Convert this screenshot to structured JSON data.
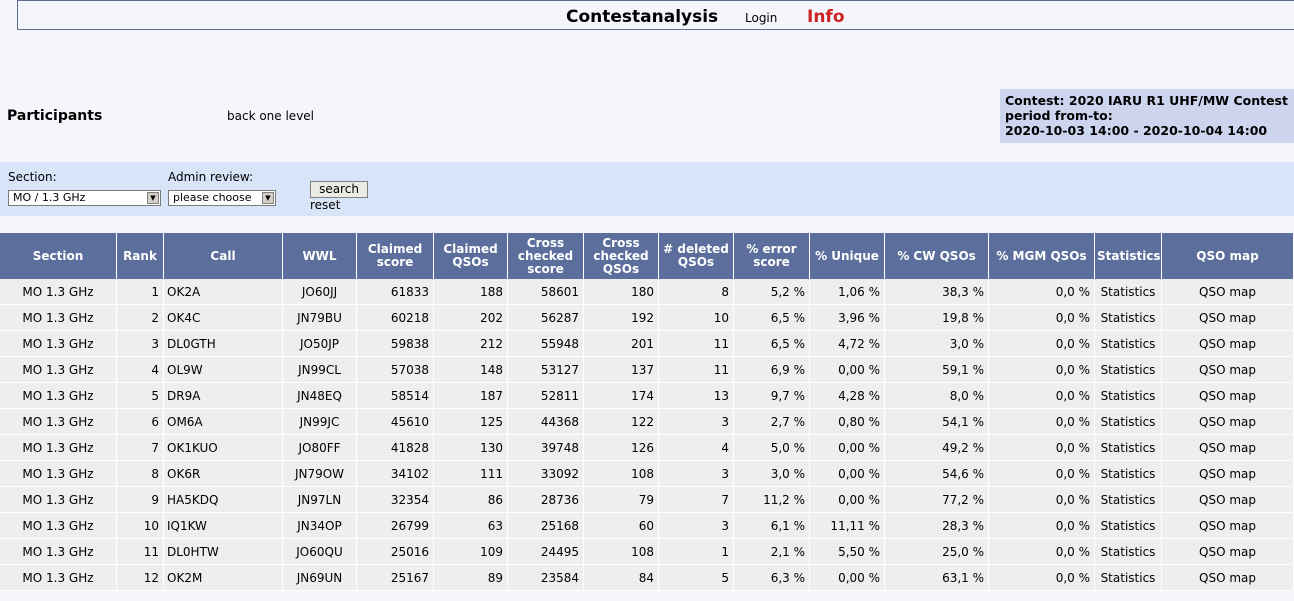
{
  "header": {
    "title": "Contestanalysis",
    "login": "Login",
    "info": "Info"
  },
  "page": {
    "heading": "Participants",
    "back": "back one level"
  },
  "contest": {
    "line1": "Contest: 2020 IARU R1 UHF/MW Contest",
    "line2": "period from-to:",
    "line3": "2020-10-03 14:00 - 2020-10-04 14:00"
  },
  "filters": {
    "section_label": "Section:",
    "section_value": "MO / 1.3 GHz",
    "review_label": "Admin review:",
    "review_value": "please choose",
    "search": "search",
    "reset": "reset"
  },
  "table": {
    "headers": [
      "Section",
      "Rank",
      "Call",
      "WWL",
      "Claimed score",
      "Claimed QSOs",
      "Cross checked score",
      "Cross checked QSOs",
      "# deleted QSOs",
      "% error score",
      "% Unique",
      "% CW QSOs",
      "% MGM QSOs",
      "Statistics",
      "QSO map"
    ],
    "rows": [
      [
        "MO 1.3 GHz",
        "1",
        "OK2A",
        "JO60JJ",
        "61833",
        "188",
        "58601",
        "180",
        "8",
        "5,2 %",
        "1,06 %",
        "38,3 %",
        "0,0 %",
        "Statistics",
        "QSO map"
      ],
      [
        "MO 1.3 GHz",
        "2",
        "OK4C",
        "JN79BU",
        "60218",
        "202",
        "56287",
        "192",
        "10",
        "6,5 %",
        "3,96 %",
        "19,8 %",
        "0,0 %",
        "Statistics",
        "QSO map"
      ],
      [
        "MO 1.3 GHz",
        "3",
        "DL0GTH",
        "JO50JP",
        "59838",
        "212",
        "55948",
        "201",
        "11",
        "6,5 %",
        "4,72 %",
        "3,0 %",
        "0,0 %",
        "Statistics",
        "QSO map"
      ],
      [
        "MO 1.3 GHz",
        "4",
        "OL9W",
        "JN99CL",
        "57038",
        "148",
        "53127",
        "137",
        "11",
        "6,9 %",
        "0,00 %",
        "59,1 %",
        "0,0 %",
        "Statistics",
        "QSO map"
      ],
      [
        "MO 1.3 GHz",
        "5",
        "DR9A",
        "JN48EQ",
        "58514",
        "187",
        "52811",
        "174",
        "13",
        "9,7 %",
        "4,28 %",
        "8,0 %",
        "0,0 %",
        "Statistics",
        "QSO map"
      ],
      [
        "MO 1.3 GHz",
        "6",
        "OM6A",
        "JN99JC",
        "45610",
        "125",
        "44368",
        "122",
        "3",
        "2,7 %",
        "0,80 %",
        "54,1 %",
        "0,0 %",
        "Statistics",
        "QSO map"
      ],
      [
        "MO 1.3 GHz",
        "7",
        "OK1KUO",
        "JO80FF",
        "41828",
        "130",
        "39748",
        "126",
        "4",
        "5,0 %",
        "0,00 %",
        "49,2 %",
        "0,0 %",
        "Statistics",
        "QSO map"
      ],
      [
        "MO 1.3 GHz",
        "8",
        "OK6R",
        "JN79OW",
        "34102",
        "111",
        "33092",
        "108",
        "3",
        "3,0 %",
        "0,00 %",
        "54,6 %",
        "0,0 %",
        "Statistics",
        "QSO map"
      ],
      [
        "MO 1.3 GHz",
        "9",
        "HA5KDQ",
        "JN97LN",
        "32354",
        "86",
        "28736",
        "79",
        "7",
        "11,2 %",
        "0,00 %",
        "77,2 %",
        "0,0 %",
        "Statistics",
        "QSO map"
      ],
      [
        "MO 1.3 GHz",
        "10",
        "IQ1KW",
        "JN34OP",
        "26799",
        "63",
        "25168",
        "60",
        "3",
        "6,1 %",
        "11,11 %",
        "28,3 %",
        "0,0 %",
        "Statistics",
        "QSO map"
      ],
      [
        "MO 1.3 GHz",
        "11",
        "DL0HTW",
        "JO60QU",
        "25016",
        "109",
        "24495",
        "108",
        "1",
        "2,1 %",
        "5,50 %",
        "25,0 %",
        "0,0 %",
        "Statistics",
        "QSO map"
      ],
      [
        "MO 1.3 GHz",
        "12",
        "OK2M",
        "JN69UN",
        "25167",
        "89",
        "23584",
        "84",
        "5",
        "6,3 %",
        "0,00 %",
        "63,1 %",
        "0,0 %",
        "Statistics",
        "QSO map"
      ]
    ]
  },
  "colors": {
    "header_bg": "#5c6f9c",
    "filter_bg": "#d8e4f8",
    "contest_bg": "#ccd4ee",
    "info": "#cc2222"
  }
}
